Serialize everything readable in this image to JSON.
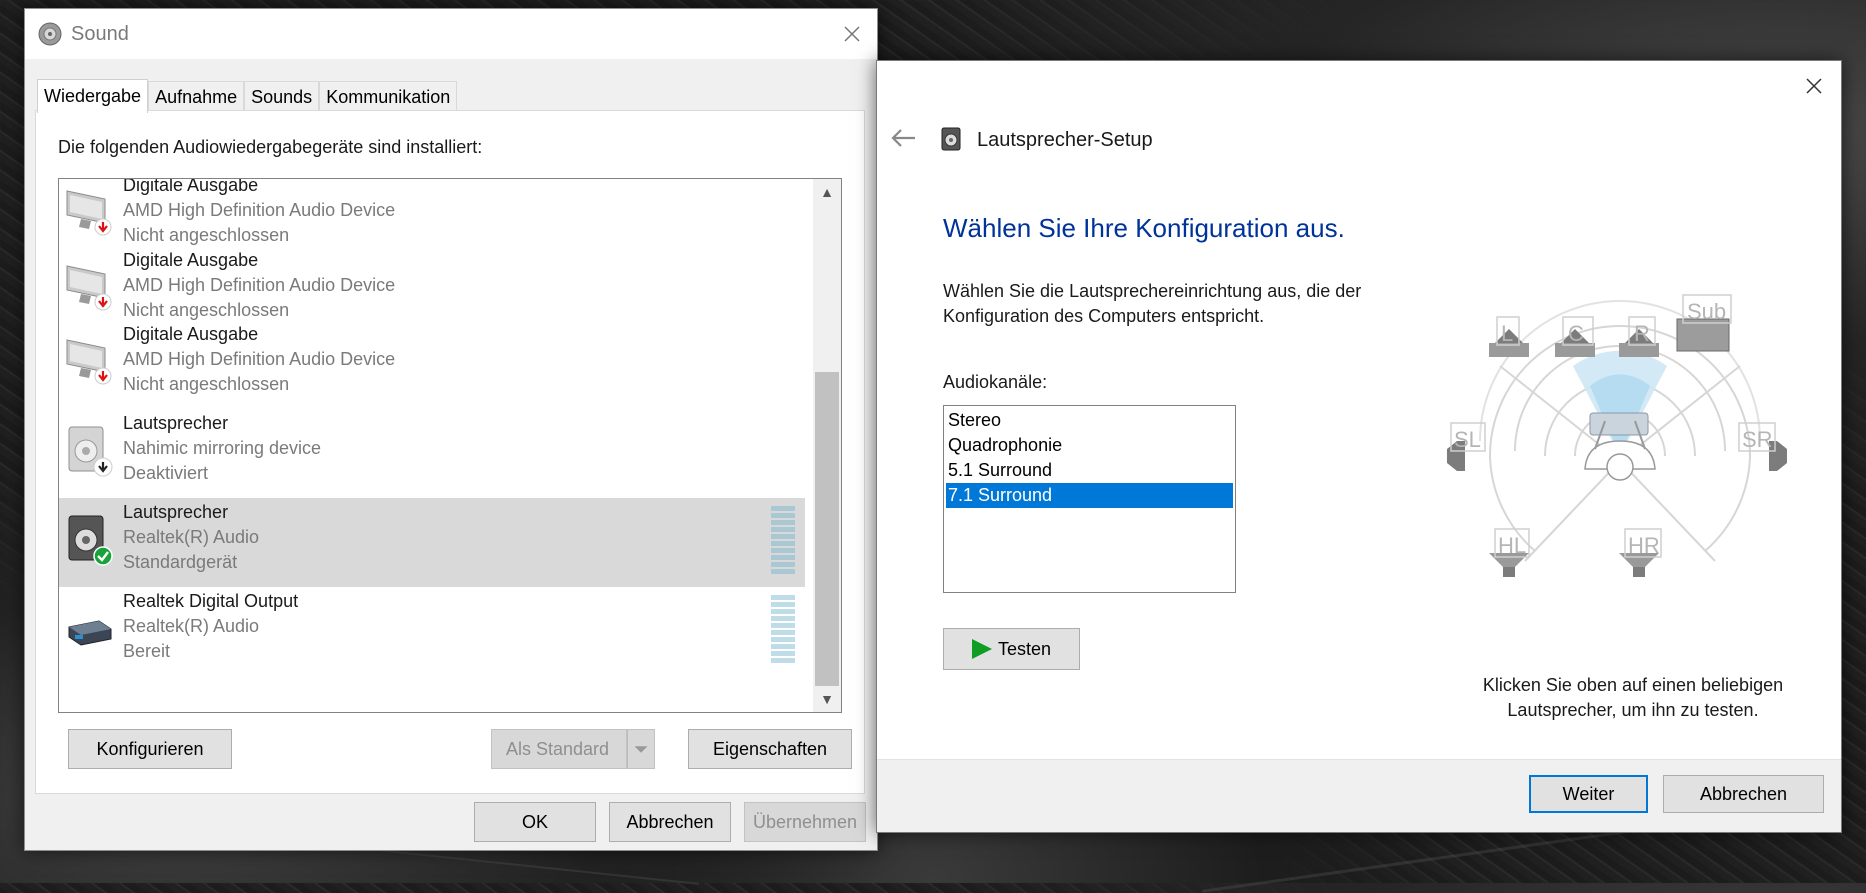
{
  "sound_dialog": {
    "title": "Sound",
    "tabs": [
      "Wiedergabe",
      "Aufnahme",
      "Sounds",
      "Kommunikation"
    ],
    "intro": "Die folgenden Audiowiedergabegeräte sind installiert:",
    "devices": [
      {
        "name": "Digitale Ausgabe",
        "desc": "AMD High Definition Audio Device",
        "status": "Nicht angeschlossen",
        "icon": "monitor-disconnected-icon"
      },
      {
        "name": "Digitale Ausgabe",
        "desc": "AMD High Definition Audio Device",
        "status": "Nicht angeschlossen",
        "icon": "monitor-disconnected-icon"
      },
      {
        "name": "Digitale Ausgabe",
        "desc": "AMD High Definition Audio Device",
        "status": "Nicht angeschlossen",
        "icon": "monitor-disconnected-icon"
      },
      {
        "name": "Lautsprecher",
        "desc": "Nahimic mirroring device",
        "status": "Deaktiviert",
        "icon": "speaker-disabled-icon"
      },
      {
        "name": "Lautsprecher",
        "desc": "Realtek(R) Audio",
        "status": "Standardgerät",
        "icon": "speaker-default-icon"
      },
      {
        "name": "Realtek Digital Output",
        "desc": "Realtek(R) Audio",
        "status": "Bereit",
        "icon": "digital-output-icon"
      }
    ],
    "buttons": {
      "configure": "Konfigurieren",
      "set_default": "Als Standard",
      "properties": "Eigenschaften",
      "ok": "OK",
      "cancel": "Abbrechen",
      "apply": "Übernehmen"
    }
  },
  "wizard": {
    "title": "Lautsprecher-Setup",
    "heading": "Wählen Sie Ihre Konfiguration aus.",
    "description": "Wählen Sie die Lautsprechereinrichtung aus, die der Konfiguration des Computers entspricht.",
    "channels_label": "Audiokanäle:",
    "channels": [
      "Stereo",
      "Quadrophonie",
      "5.1 Surround",
      "7.1 Surround"
    ],
    "selected_channel": "7.1 Surround",
    "test_button": "Testen",
    "speakers": [
      "L",
      "C",
      "R",
      "Sub",
      "SL",
      "SR",
      "HL",
      "HR"
    ],
    "hint": "Klicken Sie oben auf einen beliebigen Lautsprecher, um ihn zu testen.",
    "next_button": "Weiter",
    "cancel_button": "Abbrechen"
  },
  "colors": {
    "accent": "#0078d7",
    "heading": "#003399",
    "test_play": "#0f9d24",
    "selected_row": "#d9d9d9"
  }
}
